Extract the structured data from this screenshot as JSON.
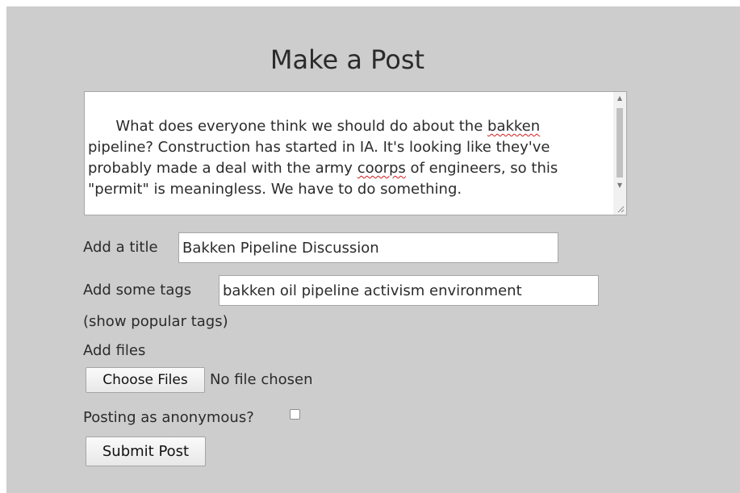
{
  "page": {
    "title": "Make a Post"
  },
  "body_field": {
    "segments": [
      {
        "text": "What does everyone think we should do about the ",
        "spell": false
      },
      {
        "text": "bakken",
        "spell": true
      },
      {
        "text": " pipeline? Construction has started in IA. It's looking like they've probably made a deal with the army ",
        "spell": false
      },
      {
        "text": "coorps",
        "spell": true
      },
      {
        "text": " of engineers, so this \"permit\" is meaningless. We have to do something.",
        "spell": false
      }
    ]
  },
  "title_field": {
    "label": "Add a title",
    "value": "Bakken Pipeline Discussion"
  },
  "tags_field": {
    "label": "Add some tags",
    "value": "bakken oil pipeline activism environment"
  },
  "popular_tags_link": "(show popular tags)",
  "files": {
    "label": "Add files",
    "button_label": "Choose Files",
    "status": "No file chosen"
  },
  "anonymous": {
    "label": "Posting as anonymous?",
    "checked": false
  },
  "submit": {
    "label": "Submit Post"
  }
}
